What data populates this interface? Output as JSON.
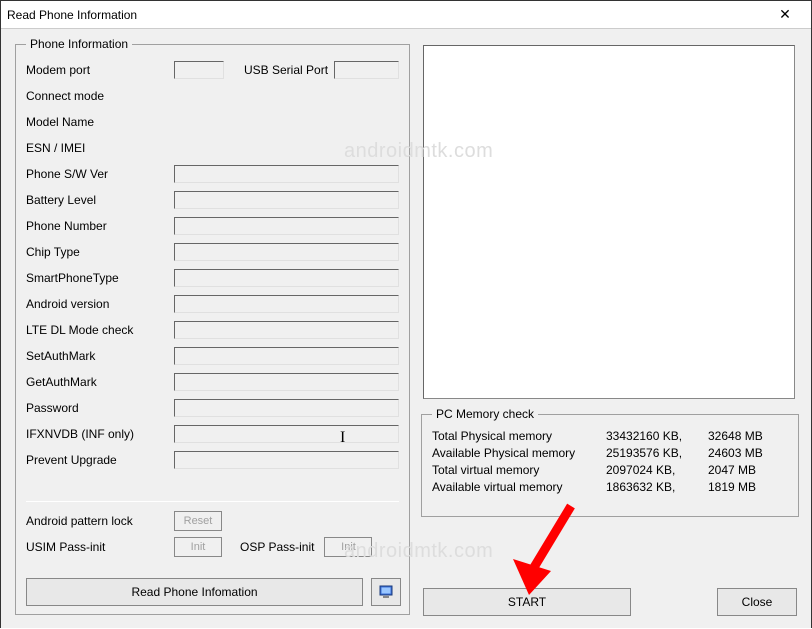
{
  "window": {
    "title": "Read Phone Information",
    "close_label": "✕"
  },
  "watermark": "androidmtk.com",
  "phone_info": {
    "legend": "Phone Information",
    "rows": {
      "modem_port": "Modem port",
      "usb_serial": "USB Serial Port",
      "connect_mode": "Connect mode",
      "model_name": "Model Name",
      "esn_imei": "ESN / IMEI",
      "phone_sw_ver": "Phone S/W Ver",
      "battery_level": "Battery Level",
      "phone_number": "Phone Number",
      "chip_type": "Chip Type",
      "smartphone_type": "SmartPhoneType",
      "android_version": "Android version",
      "lte_dl_mode": "LTE DL Mode check",
      "set_auth_mark": "SetAuthMark",
      "get_auth_mark": "GetAuthMark",
      "password": "Password",
      "ifxnvdb": "IFXNVDB (INF only)",
      "prevent_upgrade": "Prevent Upgrade"
    },
    "actions": {
      "android_pattern_lock": "Android pattern lock",
      "reset": "Reset",
      "usim_pass_init": "USIM Pass-init",
      "init": "Init",
      "osp_pass_init": "OSP Pass-init",
      "read_phone_info": "Read Phone Infomation"
    }
  },
  "pc_memory": {
    "legend": "PC Memory check",
    "rows": [
      {
        "label": "Total Physical memory",
        "kb": "33432160 KB,",
        "mb": "32648 MB"
      },
      {
        "label": "Available Physical memory",
        "kb": "25193576 KB,",
        "mb": "24603 MB"
      },
      {
        "label": "Total virtual memory",
        "kb": "2097024 KB,",
        "mb": "2047 MB"
      },
      {
        "label": "Available virtual memory",
        "kb": "1863632 KB,",
        "mb": "1819 MB"
      }
    ]
  },
  "buttons": {
    "start": "START",
    "close": "Close"
  }
}
